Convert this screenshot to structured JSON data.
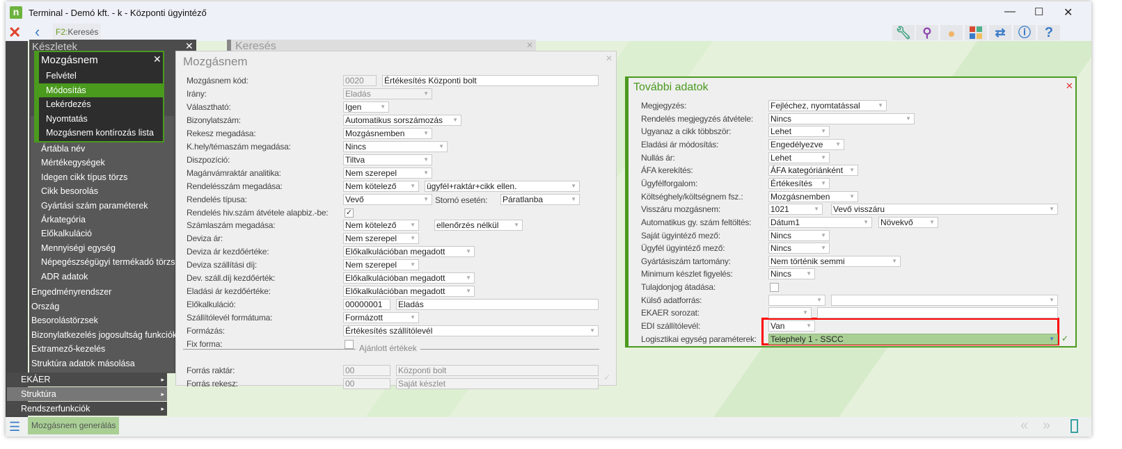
{
  "window": {
    "title": "Terminal - Demó kft. - k - Központi ügyintéző",
    "logo": "n"
  },
  "toolbar": {
    "f2_key": "F2:",
    "f2_label": "Keresés",
    "icons": [
      "wrench-icon",
      "search-icon",
      "user-icon",
      "tiles-icon",
      "swap-icon",
      "info-icon",
      "help-icon"
    ]
  },
  "keszletek": {
    "title": "Készletek"
  },
  "kereses": {
    "title": "Keresés"
  },
  "popup": {
    "title": "Mozgásnem",
    "items": [
      "Felvétel",
      "Módosítás",
      "Lekérdezés",
      "Nyomtatás",
      "Mozgásnem kontírozás lista"
    ],
    "selected": 1
  },
  "submenu": [
    "Ártábla név",
    "Mértékegységek",
    "Idegen cikk típus törzs",
    "Cikk besorolás",
    "Gyártási szám paraméterek",
    "Árkategória",
    "Előkalkuláció",
    "Mennyiségi egység",
    "Népegészségügyi termékadó törzs",
    "ADR adatok"
  ],
  "menu2": [
    "Engedményrendszer",
    "Ország",
    "Besorolástörzsek",
    "Bizonylatkezelés jogosultság funkciók",
    "Extramező-kezelés",
    "Struktúra adatok másolása"
  ],
  "menu3": [
    "EKÁER",
    "Struktúra",
    "Rendszerfunkciók"
  ],
  "form": {
    "title": "Mozgásnem",
    "section": "Ajánlott értékek",
    "rows": [
      [
        "Mozgásnem kód:",
        [
          [
            "0020",
            48,
            "t",
            1
          ],
          [
            "Értékesítés Központi bolt",
            311,
            "t",
            0,
            56
          ]
        ]
      ],
      [
        "Irány:",
        [
          [
            "Eladás",
            128,
            "d",
            1
          ]
        ]
      ],
      [
        "Választható:",
        [
          [
            "Igen",
            66,
            "d"
          ]
        ]
      ],
      [
        "Bizonylatszám:",
        [
          [
            "Automatikus sorszámozás",
            170,
            "d"
          ]
        ]
      ],
      [
        "Rekesz megadása:",
        [
          [
            "Mozgásnemben",
            128,
            "d"
          ]
        ]
      ],
      [
        "K.hely/témaszám megadása:",
        [
          [
            "Nincs",
            150,
            "d"
          ]
        ]
      ],
      [
        "Diszpozíció:",
        [
          [
            "Tiltva",
            128,
            "d"
          ]
        ]
      ],
      [
        "Magánvámraktár analitika:",
        [
          [
            "Nem szerepel",
            128,
            "d"
          ]
        ]
      ],
      [
        "Rendelésszám megadása:",
        [
          [
            "Nem kötelező",
            109,
            "d"
          ],
          [
            "ügyfél+raktár+cikk ellen.",
            223,
            "d",
            0,
            117
          ]
        ]
      ],
      [
        "Rendelés típusa:",
        [
          [
            "Vevő",
            128,
            "d"
          ],
          [
            "Páratlanba",
            114,
            "d",
            0,
            226
          ]
        ]
      ],
      [
        "Rendelés hiv.szám átvétele alapbiz.-be:",
        [
          [
            "✓",
            0,
            "c"
          ]
        ]
      ],
      [
        "Számlaszám megadása:",
        [
          [
            "Nem kötelező",
            109,
            "d"
          ],
          [
            "ellenőrzés nélkül",
            127,
            "d",
            0,
            131
          ]
        ]
      ],
      [
        "Deviza ár:",
        [
          [
            "Nem szerepel",
            109,
            "d"
          ]
        ]
      ],
      [
        "Deviza ár kezdőértéke:",
        [
          [
            "Előkalkulációban megadott",
            189,
            "d"
          ]
        ]
      ],
      [
        "Deviza szállítási díj:",
        [
          [
            "Nem szerepel",
            109,
            "d"
          ]
        ]
      ],
      [
        "Dev. száll.díj kezdőérték:",
        [
          [
            "Előkalkulációban megadott",
            189,
            "d"
          ]
        ]
      ],
      [
        "Eladási ár kezdőértéke:",
        [
          [
            "Előkalkulációban megadott",
            189,
            "d"
          ]
        ]
      ],
      [
        "Előkalkuláció:",
        [
          [
            "00000001",
            68,
            "t"
          ],
          [
            "Eladás",
            291,
            "t",
            0,
            76
          ]
        ]
      ],
      [
        "Szállítólevél formátuma:",
        [
          [
            "Formázott",
            109,
            "d"
          ]
        ]
      ],
      [
        "Formázás:",
        [
          [
            "Értékesítés szállítólevél",
            367,
            "d"
          ]
        ]
      ],
      [
        "Fix forma:",
        [
          [
            "",
            0,
            "c"
          ]
        ]
      ],
      [
        "",
        []
      ],
      [
        "Forrás raktár:",
        [
          [
            "00",
            68,
            "t",
            1
          ],
          [
            "Központi bolt",
            291,
            "t",
            1,
            76
          ]
        ]
      ],
      [
        "Forrás rekesz:",
        [
          [
            "00",
            68,
            "t",
            1
          ],
          [
            "Saját készlet",
            291,
            "t",
            1,
            76
          ]
        ]
      ]
    ],
    "storno_label": "Stornó esetén:"
  },
  "extra": {
    "title": "További adatok",
    "rows": [
      [
        "Megjegyzés:",
        [
          [
            "Fejléchez, nyomtatással",
            170,
            "d"
          ]
        ]
      ],
      [
        "Rendelés megjegyzés átvétele:",
        [
          [
            "Nincs",
            210,
            "d"
          ]
        ]
      ],
      [
        "Ugyanaz a cikk többször:",
        [
          [
            "Lehet",
            88,
            "d"
          ]
        ]
      ],
      [
        "Eladási ár módosítás:",
        [
          [
            "Engedélyezve",
            109,
            "d"
          ]
        ]
      ],
      [
        "Nullás ár:",
        [
          [
            "Lehet",
            88,
            "d"
          ]
        ]
      ],
      [
        "ÁFA kerekítés:",
        [
          [
            "ÁFA kategóriánként",
            129,
            "d"
          ]
        ]
      ],
      [
        "Ügyfélforgalom:",
        [
          [
            "Értékesítés",
            88,
            "d"
          ]
        ]
      ],
      [
        "Költséghely/költségnem fsz.:",
        [
          [
            "Mozgásnemben",
            129,
            "d"
          ]
        ]
      ],
      [
        "Visszáru mozgásnem:",
        [
          [
            "1021",
            78,
            "d"
          ],
          [
            "Vevő visszáru",
            326,
            "d",
            0,
            90
          ]
        ]
      ],
      [
        "Automatikus gy. szám feltöltés:",
        [
          [
            "Dátum1",
            149,
            "d"
          ],
          [
            "Növekvő",
            86,
            "d",
            0,
            158
          ]
        ]
      ],
      [
        "Saját ügyintéző mező:",
        [
          [
            "Nincs",
            88,
            "d"
          ]
        ]
      ],
      [
        "Ügyfél ügyintéző mező:",
        [
          [
            "Nincs",
            88,
            "d"
          ]
        ]
      ],
      [
        "Gyártásiszám tartomány:",
        [
          [
            "Nem történik semmi",
            190,
            "d"
          ]
        ]
      ],
      [
        "Minimum készlet figyelés:",
        [
          [
            "Nincs",
            67,
            "d"
          ]
        ]
      ],
      [
        "Tulajdonjog átadása:",
        [
          [
            "",
            0,
            "c"
          ]
        ]
      ],
      [
        "Külső adatforrás:",
        [
          [
            "",
            82,
            "d"
          ],
          [
            "",
            326,
            "d",
            0,
            90
          ]
        ]
      ],
      [
        "EKAER sorozat:",
        [
          [
            "",
            62,
            "d"
          ],
          [
            "",
            346,
            "t",
            0,
            70
          ]
        ]
      ],
      [
        "EDI szállítólevél:",
        [
          [
            "Van",
            67,
            "d"
          ]
        ]
      ],
      [
        "Logisztikai egység paraméterek:",
        [
          [
            "Telephely 1 - SSCC",
            416,
            "g"
          ]
        ]
      ]
    ]
  },
  "statusbar": {
    "button": "Mozgásnem generálás"
  },
  "colors": {
    "accent": "#4a9a1e",
    "highlight": "#ff0000",
    "selected_field": "#a9cf95"
  }
}
